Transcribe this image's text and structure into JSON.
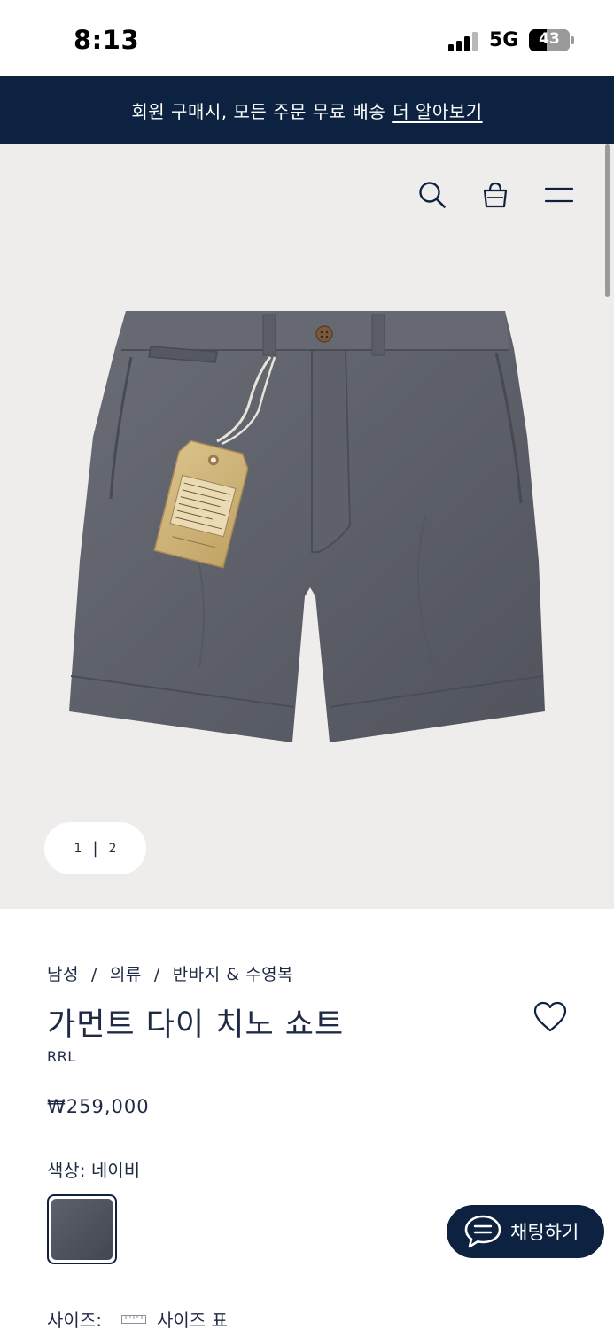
{
  "status_bar": {
    "time": "8:13",
    "network": "5G",
    "battery": "43"
  },
  "promo_banner": {
    "text": "회원 구매시, 모든 주문 무료 배송",
    "link": "더 알아보기"
  },
  "header_icons": [
    "search-icon",
    "shopping-bag-icon",
    "menu-icon"
  ],
  "gallery": {
    "pager": {
      "current": "1",
      "separator": "|",
      "total": "2"
    }
  },
  "breadcrumb": [
    {
      "label": "남성"
    },
    {
      "label": "의류"
    },
    {
      "label": "반바지 & 수영복"
    }
  ],
  "breadcrumb_separator": "/",
  "product": {
    "title": "가먼트 다이 치노 쇼트",
    "brand": "RRL",
    "price": "₩259,000",
    "color_label": "색상: 네이비",
    "swatch_color": "#55585f",
    "size_label": "사이즈:",
    "size_chart": "사이즈 표"
  },
  "chat": {
    "label": "채팅하기"
  },
  "colors": {
    "navy": "#0d2240",
    "gallery_bg": "#efedec",
    "text": "#1f2a44"
  }
}
